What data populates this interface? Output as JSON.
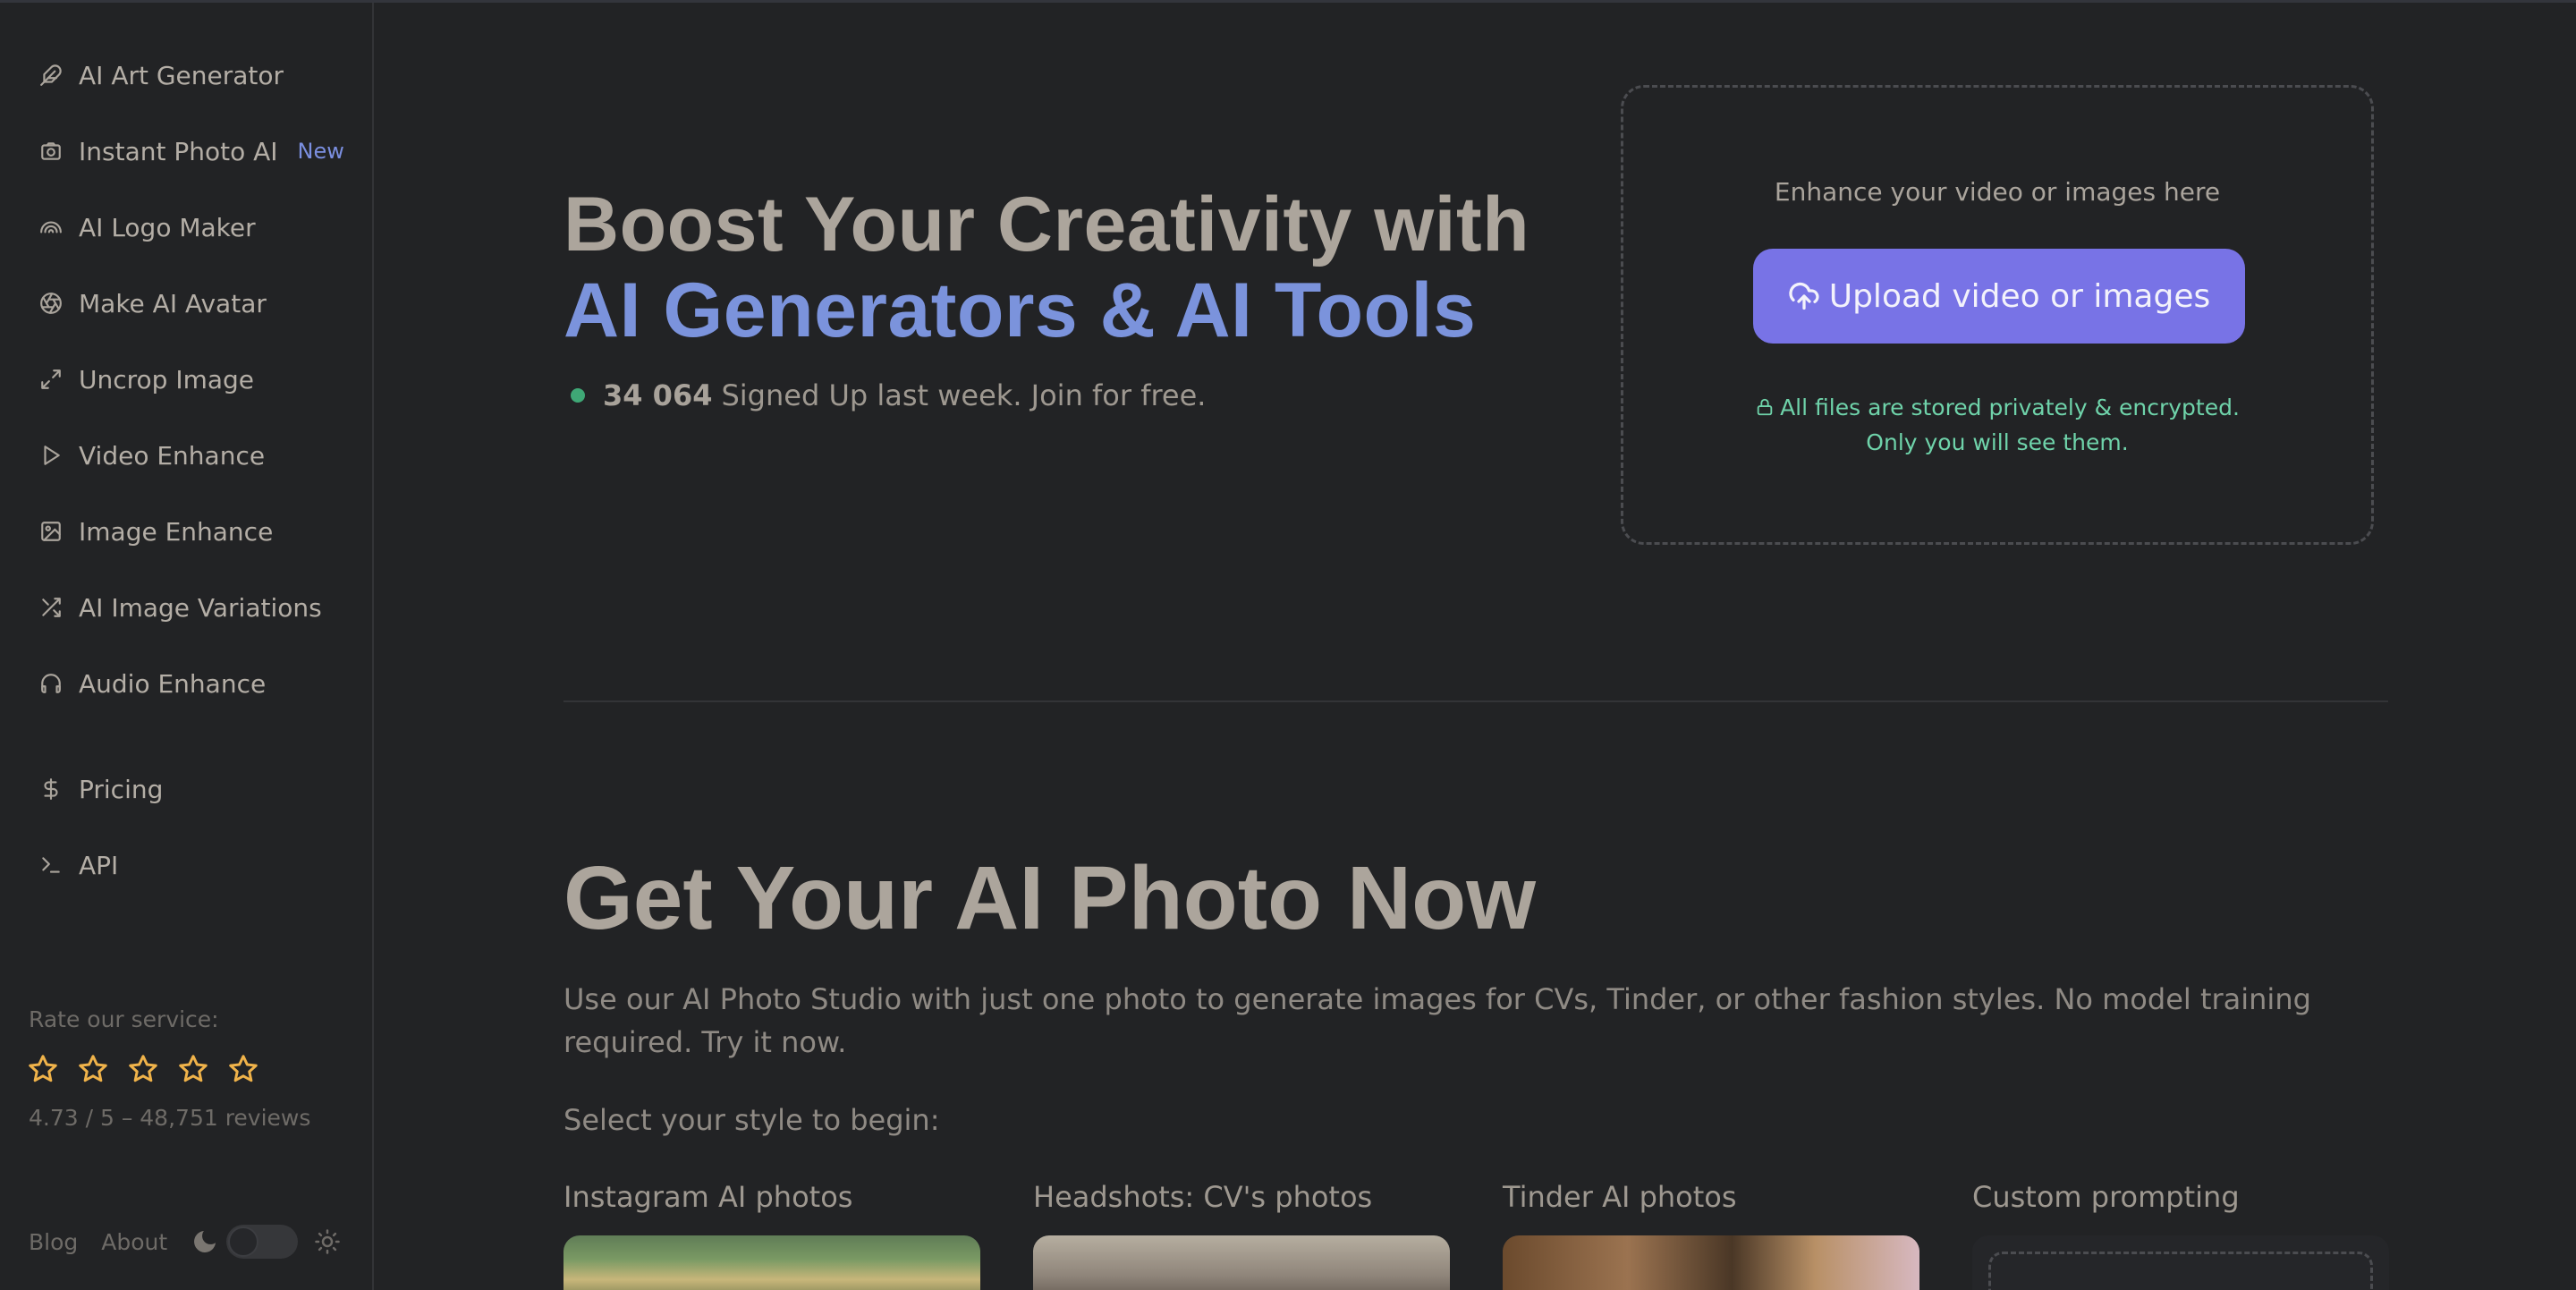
{
  "sidebar": {
    "items": [
      {
        "label": "AI Art Generator",
        "icon": "feather-icon"
      },
      {
        "label": "Instant Photo AI",
        "icon": "camera-icon",
        "badge": "New"
      },
      {
        "label": "AI Logo Maker",
        "icon": "rainbow-icon"
      },
      {
        "label": "Make AI Avatar",
        "icon": "aperture-icon"
      },
      {
        "label": "Uncrop Image",
        "icon": "expand-icon"
      },
      {
        "label": "Video Enhance",
        "icon": "play-icon"
      },
      {
        "label": "Image Enhance",
        "icon": "image-icon"
      },
      {
        "label": "AI Image Variations",
        "icon": "shuffle-icon"
      },
      {
        "label": "Audio Enhance",
        "icon": "headphones-icon"
      }
    ],
    "secondary": [
      {
        "label": "Pricing",
        "icon": "dollar-icon"
      },
      {
        "label": "API",
        "icon": "terminal-icon"
      }
    ],
    "rating": {
      "label": "Rate our service:",
      "stars": 5,
      "reviews": "4.73 / 5 – 48,751 reviews"
    },
    "footer": {
      "blog": "Blog",
      "about": "About"
    }
  },
  "hero": {
    "title_line1": "Boost Your Creativity with",
    "title_line2": "AI Generators & AI Tools",
    "signup_count": "34 064",
    "signup_text": "Signed Up last week. Join for free."
  },
  "upload": {
    "hint": "Enhance your video or images here",
    "button": "Upload video or images",
    "privacy_line1": "All files are stored privately & encrypted.",
    "privacy_line2": "Only you will see them."
  },
  "photo_section": {
    "title": "Get Your AI Photo Now",
    "description": "Use our AI Photo Studio with just one photo to generate images for CVs, Tinder, or other fashion styles. No model training required. Try it now.",
    "select_label": "Select your style to begin:",
    "styles": [
      {
        "label": "Instagram AI photos"
      },
      {
        "label": "Headshots: CV's photos"
      },
      {
        "label": "Tinder AI photos"
      },
      {
        "label": "Custom prompting"
      }
    ]
  },
  "colors": {
    "background": "#222325",
    "accent": "#7b93dc",
    "button": "#7873e6",
    "privacy": "#6fd3aa",
    "star": "#f0b34a",
    "status_dot": "#3fa876"
  }
}
